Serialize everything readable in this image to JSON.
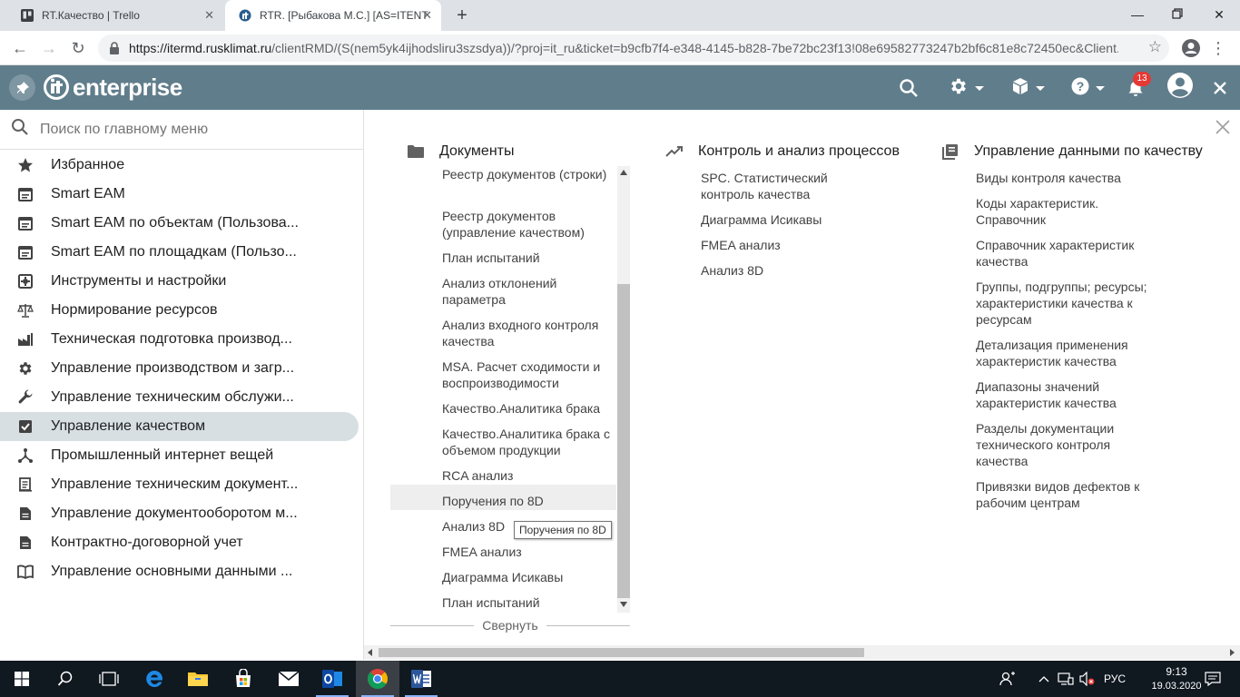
{
  "browser": {
    "tabs": [
      {
        "title": "RT.Качество | Trello",
        "favicon": "trello-icon"
      },
      {
        "title": "RTR. [Рыбакова М.С.] [AS=ITENT",
        "favicon": "it-enterprise-icon"
      }
    ],
    "url": {
      "host": "https://itermd.rusklimat.ru",
      "path": "/clientRMD/(S(nem5yk4ijhodsliru3szsdya))/?proj=it_ru&ticket=b9cfb7f4-e348-4145-b828-7be72bc23f13!08e69582773247b2bf6c81e8c72450ec&Client..."
    }
  },
  "header": {
    "logo_text": "enterprise",
    "notification_count": "13",
    "accent": "#607d8b"
  },
  "sidebar": {
    "search_placeholder": "Поиск по главному меню",
    "items": [
      {
        "label": "Избранное",
        "icon": "star-icon"
      },
      {
        "label": "Smart EAM",
        "icon": "calendar-icon"
      },
      {
        "label": "Smart EAM по объектам (Пользова...",
        "icon": "calendar-icon"
      },
      {
        "label": "Smart EAM по площадкам (Пользо...",
        "icon": "calendar-icon"
      },
      {
        "label": "Инструменты и настройки",
        "icon": "tools-box-icon"
      },
      {
        "label": "Нормирование ресурсов",
        "icon": "scales-icon"
      },
      {
        "label": "Техническая подготовка производ...",
        "icon": "factory-icon"
      },
      {
        "label": "Управление производством и загр...",
        "icon": "gear-icon"
      },
      {
        "label": "Управление техническим обслужи...",
        "icon": "wrench-icon"
      },
      {
        "label": "Управление качеством",
        "icon": "checkbox-icon"
      },
      {
        "label": "Промышленный интернет вещей",
        "icon": "hub-icon"
      },
      {
        "label": "Управление техническим документ...",
        "icon": "document-stack-icon"
      },
      {
        "label": "Управление документооборотом м...",
        "icon": "document-icon"
      },
      {
        "label": "Контрактно-договорной учет",
        "icon": "document-icon"
      },
      {
        "label": "Управление основными данными ...",
        "icon": "book-icon"
      }
    ]
  },
  "main": {
    "columns": {
      "documents": {
        "title": "Документы",
        "items": [
          "Реестр документов (строки)",
          "Реестр документов (управление качеством)",
          "План испытаний",
          "Анализ отклонений параметра",
          "Анализ входного контроля качества",
          "MSA. Расчет сходимости и воспроизводимости",
          "Качество.Аналитика брака",
          "Качество.Аналитика брака с объемом продукции",
          "RCA анализ",
          "Поручения по 8D",
          "Анализ 8D",
          "FMEA анализ",
          "Диаграмма Исикавы",
          "План испытаний"
        ],
        "collapse_label": "Свернуть",
        "tooltip": "Поручения по 8D"
      },
      "process": {
        "title": "Контроль и анализ процессов",
        "items": [
          "SPC. Статистический контроль качества",
          "Диаграмма Исикавы",
          "FMEA анализ",
          "Анализ 8D"
        ]
      },
      "quality_data": {
        "title": "Управление данными по качеству",
        "items": [
          "Виды контроля качества",
          "Коды характеристик. Справочник",
          "Справочник характеристик качества",
          "Группы, подгруппы; ресурсы; характеристики качества к ресурсам",
          "Детализация применения характеристик качества",
          "Диапазоны значений характеристик качества",
          "Разделы документации технического контроля качества",
          "Привязки видов дефектов к рабочим центрам"
        ]
      }
    }
  },
  "taskbar": {
    "language": "РУС",
    "time": "9:13",
    "date": "19.03.2020"
  }
}
